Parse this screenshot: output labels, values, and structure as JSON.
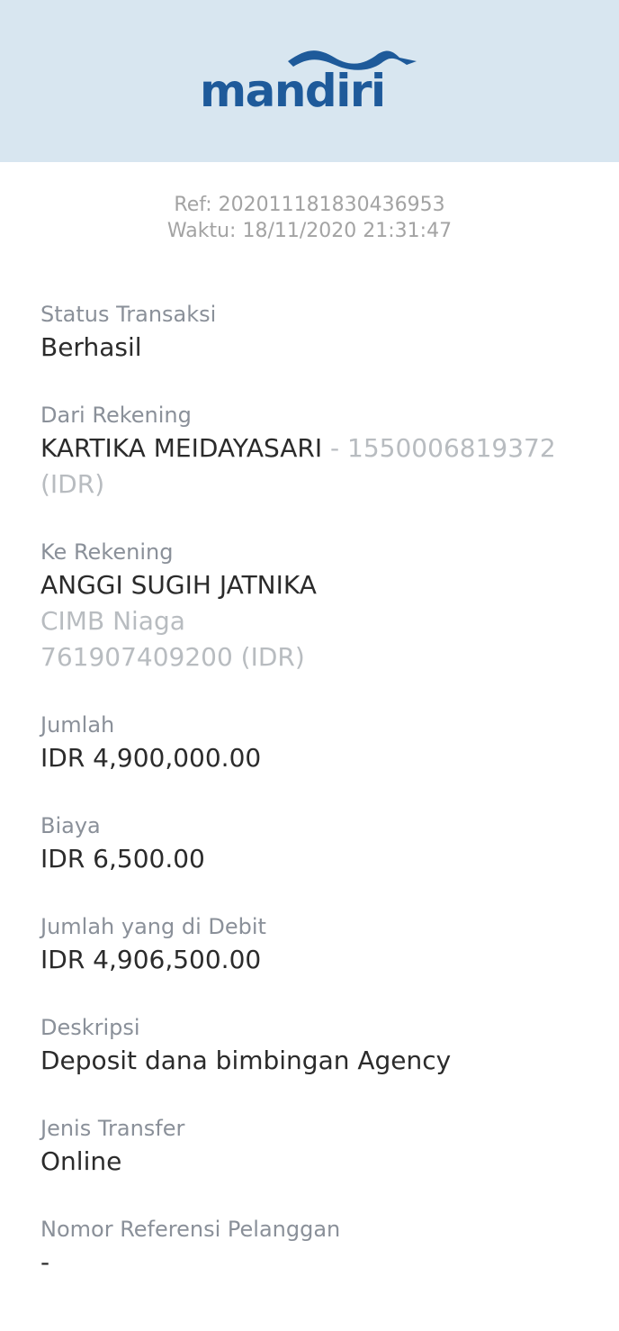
{
  "brand": {
    "name": "mandiri",
    "color": "#1e5a9a",
    "header_bg": "#d8e6f0"
  },
  "meta": {
    "ref": "Ref: 202011181830436953",
    "time": "Waktu: 18/11/2020 21:31:47"
  },
  "fields": {
    "status": {
      "label": "Status Transaksi",
      "value": "Berhasil"
    },
    "from": {
      "label": "Dari Rekening",
      "name": "KARTIKA MEIDAYASARI",
      "detail": "- 1550006819372 (IDR)"
    },
    "to": {
      "label": "Ke Rekening",
      "name": "ANGGI SUGIH JATNIKA",
      "bank": "CIMB Niaga",
      "account": "761907409200 (IDR)"
    },
    "amount": {
      "label": "Jumlah",
      "value": "IDR 4,900,000.00"
    },
    "fee": {
      "label": "Biaya",
      "value": "IDR 6,500.00"
    },
    "debited": {
      "label": "Jumlah yang di Debit",
      "value": "IDR 4,906,500.00"
    },
    "description": {
      "label": "Deskripsi",
      "value": "Deposit dana bimbingan Agency"
    },
    "transfer_type": {
      "label": "Jenis Transfer",
      "value": "Online"
    },
    "customer_ref": {
      "label": "Nomor Referensi Pelanggan",
      "value": "-"
    }
  }
}
